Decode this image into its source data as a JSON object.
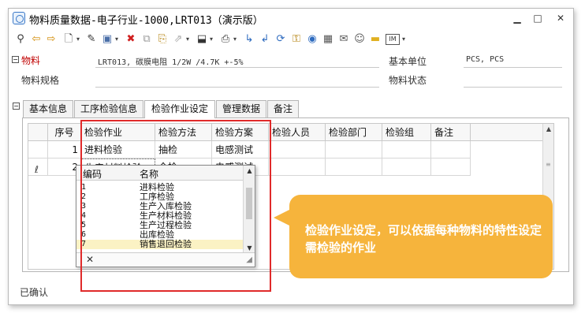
{
  "window": {
    "title": "物料质量数据-电子行业-1000,LRT013（演示版）",
    "minimize_icon": "minimize-icon",
    "maximize_icon": "maximize-icon",
    "close_icon": "close-icon"
  },
  "toolbar": {
    "icons": [
      "search-icon",
      "prev-icon",
      "next-icon",
      "new-document-icon",
      "edit-icon",
      "save-icon",
      "delete-icon",
      "copy-icon",
      "attach-icon",
      "link-icon",
      "import-icon",
      "print-icon",
      "flow-icon",
      "flow-back-icon",
      "refresh-icon",
      "lock-icon",
      "report-icon",
      "calculator-icon",
      "mail-icon",
      "chat-icon",
      "folder-icon",
      "im-icon"
    ]
  },
  "form": {
    "material_label": "物料",
    "material_value": "LRT013, 碳膜电阻 1/2W /4.7K +-5%",
    "base_unit_label": "基本单位",
    "base_unit_value": "PCS, PCS",
    "spec_label": "物料规格",
    "spec_value": "",
    "status_label": "物料状态",
    "status_value": ""
  },
  "tabs": [
    {
      "label": "基本信息"
    },
    {
      "label": "工序检验信息"
    },
    {
      "label": "检验作业设定"
    },
    {
      "label": "管理数据"
    },
    {
      "label": "备注"
    }
  ],
  "active_tab": "检验作业设定",
  "grid": {
    "columns": [
      "序号",
      "检验作业",
      "检验方法",
      "检验方案",
      "检验人员",
      "检验部门",
      "检验组",
      "备注"
    ],
    "rows": [
      {
        "seq": "1",
        "job": "进料检验",
        "method": "抽检",
        "plan": "电感测试"
      },
      {
        "seq": "2",
        "job": "生产材料检验",
        "method": "全检",
        "plan": "电感测试"
      }
    ]
  },
  "popup": {
    "col_code": "编码",
    "col_name": "名称",
    "items": [
      {
        "code": "1",
        "name": "进料检验"
      },
      {
        "code": "2",
        "name": "工序检验"
      },
      {
        "code": "3",
        "name": "生产入库检验"
      },
      {
        "code": "4",
        "name": "生产材料检验"
      },
      {
        "code": "5",
        "name": "生产过程检验"
      },
      {
        "code": "6",
        "name": "出库检验"
      },
      {
        "code": "7",
        "name": "销售退回检验"
      }
    ],
    "selected_code": "7"
  },
  "callout": {
    "text": "检验作业设定，可以依据每种物料的特性设定需检验的作业"
  },
  "status": {
    "text": "已确认"
  },
  "colors": {
    "highlight_border": "#e02a2a",
    "callout_bg": "#f6b43c",
    "material_label": "#c00000"
  }
}
